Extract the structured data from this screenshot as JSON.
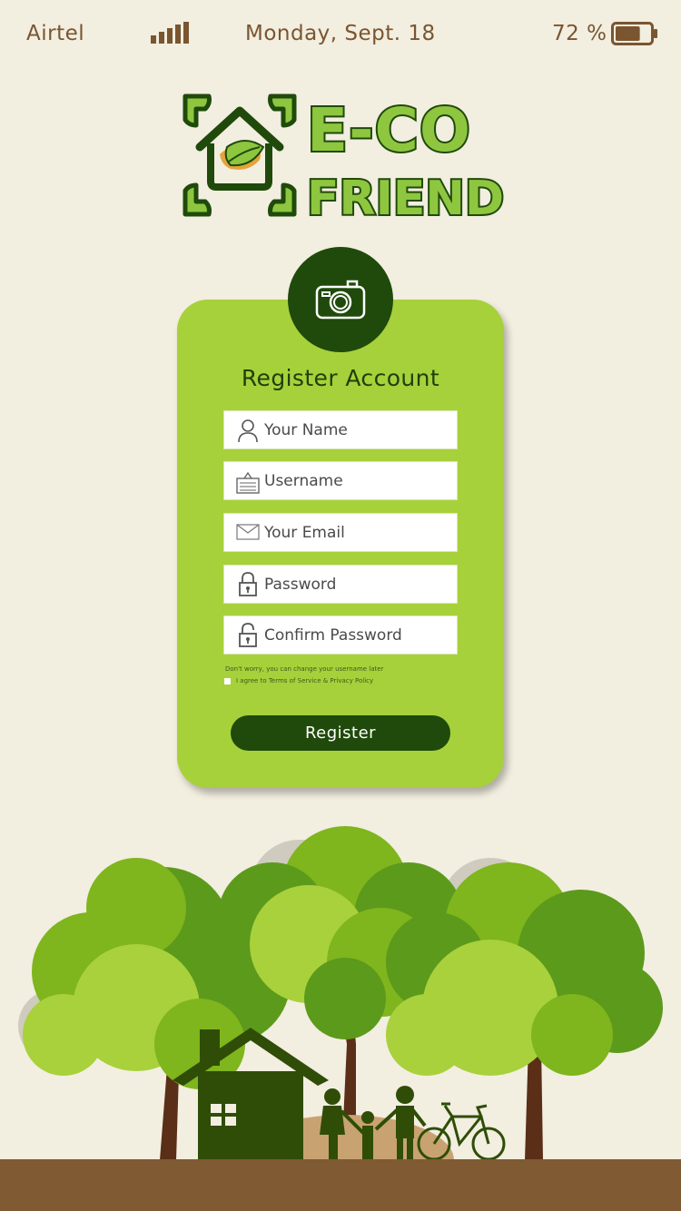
{
  "status_bar": {
    "carrier": "Airtel",
    "date": "Monday, Sept. 18",
    "battery_percent": "72 %",
    "battery_level": 0.72
  },
  "logo": {
    "line1": "E-CO",
    "line2": "FRIEND"
  },
  "form": {
    "title": "Register Account",
    "fields": [
      {
        "placeholder": "Your Name",
        "icon": "person-icon"
      },
      {
        "placeholder": "Username",
        "icon": "id-card-icon"
      },
      {
        "placeholder": "Your Email",
        "icon": "envelope-icon"
      },
      {
        "placeholder": "Password",
        "icon": "lock-icon"
      },
      {
        "placeholder": "Confirm Password",
        "icon": "unlock-icon"
      }
    ],
    "hint": "Don't worry, you can change your username later",
    "agree_label": "I agree to Terms of Service & Privacy Policy",
    "submit_label": "Register"
  },
  "colors": {
    "background": "#f2eee0",
    "card": "#a7d13a",
    "dark_green": "#1f4a0b",
    "ground": "#7f5a33",
    "status_text": "#7a5530"
  }
}
